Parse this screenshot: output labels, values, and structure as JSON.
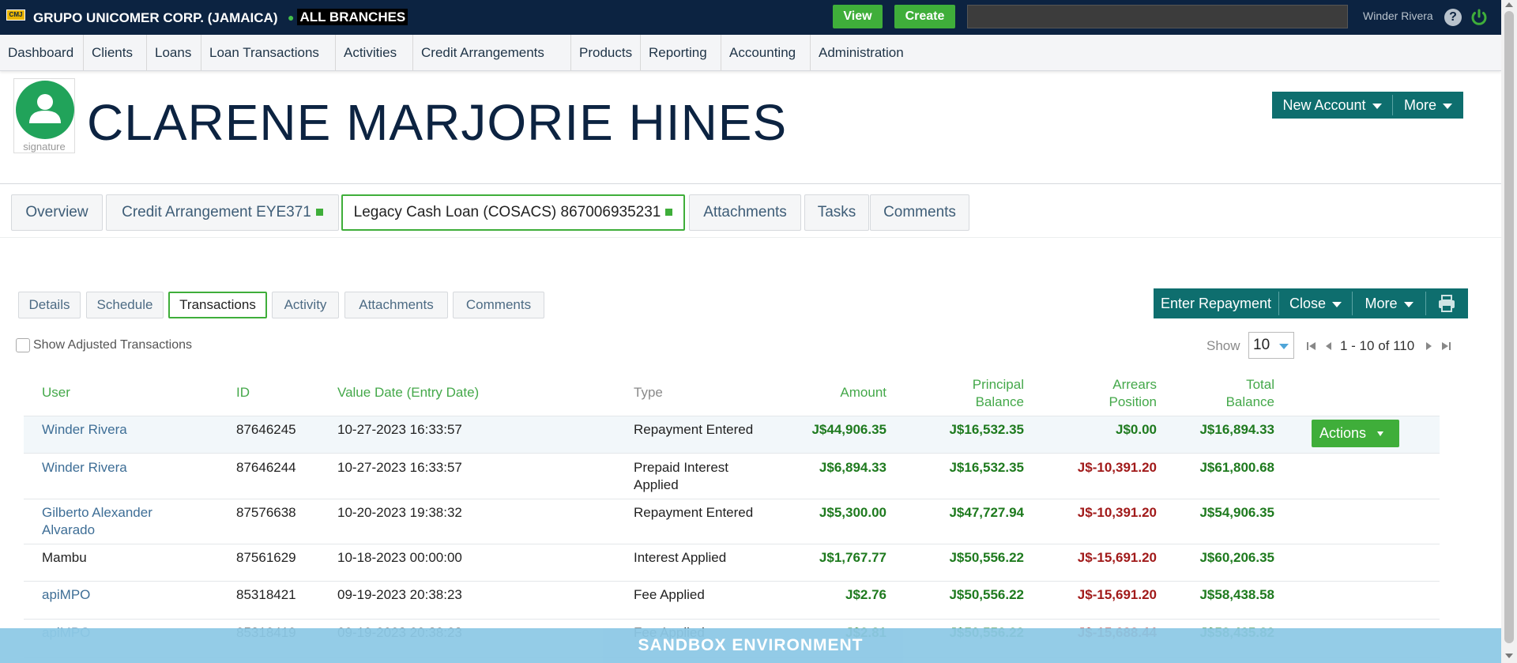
{
  "topbar": {
    "logo_text": "CMJ",
    "org_name": "GRUPO UNICOMER CORP. (JAMAICA)",
    "branches": "ALL BRANCHES",
    "view_label": "View",
    "create_label": "Create",
    "search_value": "",
    "user_name": "Winder Rivera",
    "help_label": "?",
    "help_icon": "help-icon",
    "power_icon": "power-icon"
  },
  "nav": {
    "items": [
      "Dashboard",
      "Clients",
      "Loans",
      "Loan Transactions",
      "Activities",
      "Credit Arrangements",
      "Products",
      "Reporting",
      "Accounting",
      "Administration"
    ]
  },
  "client": {
    "name": "CLARENE MARJORIE HINES",
    "signature_label": "signature",
    "new_account_label": "New Account",
    "more_label": "More"
  },
  "record_tabs": {
    "overview": "Overview",
    "credit_arrangement": "Credit Arrangement EYE371",
    "legacy_loan": "Legacy Cash Loan (COSACS) 867006935231",
    "attachments": "Attachments",
    "tasks": "Tasks",
    "comments": "Comments"
  },
  "sub_tabs": {
    "details": "Details",
    "schedule": "Schedule",
    "transactions": "Transactions",
    "activity": "Activity",
    "attachments": "Attachments",
    "comments": "Comments"
  },
  "toolbar": {
    "enter_repayment": "Enter Repayment",
    "close": "Close",
    "more": "More",
    "print_icon": "print-icon"
  },
  "filters": {
    "show_adjusted": "Show Adjusted Transactions",
    "show_label": "Show",
    "page_size": "10",
    "pagination_text": "1 - 10 of 110"
  },
  "table": {
    "headers": {
      "user": "User",
      "id": "ID",
      "value_date": "Value Date (Entry Date)",
      "type": "Type",
      "amount": "Amount",
      "principal_1": "Principal",
      "principal_2": "Balance",
      "arrears_1": "Arrears",
      "arrears_2": "Position",
      "total_1": "Total",
      "total_2": "Balance"
    },
    "rows": [
      {
        "user_1": "Winder Rivera",
        "user_2": "",
        "id": "87646245",
        "date": "10-27-2023 16:33:57",
        "type_1": "Repayment Entered",
        "type_2": "",
        "amount": "J$44,906.35",
        "principal": "J$16,532.35",
        "arrears": "J$0.00",
        "total": "J$16,894.33"
      },
      {
        "user_1": "Winder Rivera",
        "user_2": "",
        "id": "87646244",
        "date": "10-27-2023 16:33:57",
        "type_1": "Prepaid Interest",
        "type_2": "Applied",
        "amount": "J$6,894.33",
        "principal": "J$16,532.35",
        "arrears": "J$-10,391.20",
        "total": "J$61,800.68"
      },
      {
        "user_1": "Gilberto Alexander",
        "user_2": "Alvarado",
        "id": "87576638",
        "date": "10-20-2023 19:38:32",
        "type_1": "Repayment Entered",
        "type_2": "",
        "amount": "J$5,300.00",
        "principal": "J$47,727.94",
        "arrears": "J$-10,391.20",
        "total": "J$54,906.35"
      },
      {
        "user_1": "Mambu",
        "user_2": "",
        "id": "87561629",
        "date": "10-18-2023 00:00:00",
        "type_1": "Interest Applied",
        "type_2": "",
        "amount": "J$1,767.77",
        "principal": "J$50,556.22",
        "arrears": "J$-15,691.20",
        "total": "J$60,206.35"
      },
      {
        "user_1": "apiMPO",
        "user_2": "",
        "id": "85318421",
        "date": "09-19-2023 20:38:23",
        "type_1": "Fee Applied",
        "type_2": "",
        "amount": "J$2.76",
        "principal": "J$50,556.22",
        "arrears": "J$-15,691.20",
        "total": "J$58,438.58"
      },
      {
        "user_1": "apiMPO",
        "user_2": "",
        "id": "85318419",
        "date": "09-19-2023 20:38:23",
        "type_1": "Fee Applied",
        "type_2": "",
        "amount": "J$2.81",
        "principal": "J$50,556.22",
        "arrears": "J$-15,688.44",
        "total": "J$58,435.82"
      }
    ],
    "actions_label": "Actions"
  },
  "banner": {
    "text": "SANDBOX ENVIRONMENT"
  },
  "colors": {
    "topbar": "#0c2341",
    "accent_green": "#3fae3a",
    "teal": "#0e6e6e",
    "positive": "#1e7a1e",
    "negative": "#a11a1a",
    "banner": "#8ec9e6"
  }
}
